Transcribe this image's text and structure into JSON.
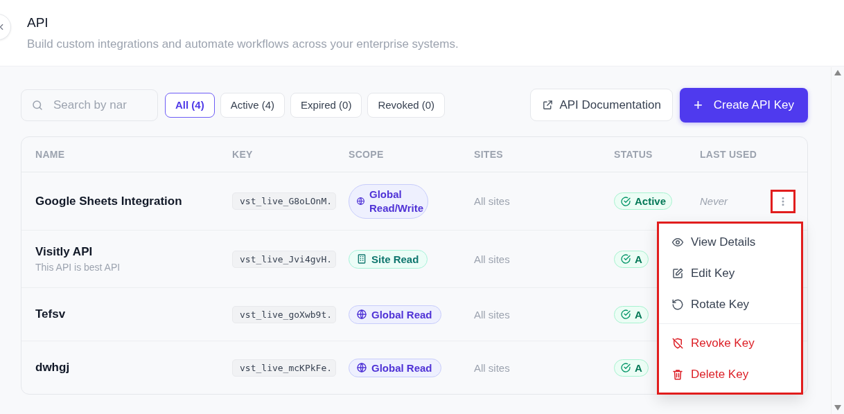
{
  "header": {
    "title": "API",
    "subtitle": "Build custom integrations and automate workflows across your enterprise systems."
  },
  "search": {
    "placeholder": "Search by nar"
  },
  "filters": [
    {
      "label": "All (4)",
      "selected": true
    },
    {
      "label": "Active (4)",
      "selected": false
    },
    {
      "label": "Expired (0)",
      "selected": false
    },
    {
      "label": "Revoked (0)",
      "selected": false
    }
  ],
  "buttons": {
    "docs": "API Documentation",
    "create_icon": "+",
    "create": "Create API Key"
  },
  "table": {
    "columns": [
      "NAME",
      "KEY",
      "SCOPE",
      "SITES",
      "STATUS",
      "LAST USED"
    ],
    "rows": [
      {
        "name": "Google Sheets Integration",
        "key": "vst_live_G8oLOnM.",
        "scope": {
          "kind": "global",
          "label": "Global Read/Write"
        },
        "sites": "All sites",
        "status": "Active",
        "last_used": "Never",
        "menu_open": true
      },
      {
        "name": "Visitly API",
        "description": "This API is best API",
        "key": "vst_live_Jvi4gvH.",
        "scope": {
          "kind": "site",
          "label": "Site Read"
        },
        "sites": "All sites",
        "status": "A"
      },
      {
        "name": "Tefsv",
        "key": "vst_live_goXwb9t.",
        "scope": {
          "kind": "global",
          "label": "Global Read"
        },
        "sites": "All sites",
        "status": "A"
      },
      {
        "name": "dwhgj",
        "key": "vst_live_mcKPkFe.",
        "scope": {
          "kind": "global",
          "label": "Global Read"
        },
        "sites": "All sites",
        "status": "A"
      }
    ]
  },
  "menu": [
    {
      "kind": "view",
      "label": "View Details"
    },
    {
      "kind": "edit",
      "label": "Edit Key"
    },
    {
      "kind": "rotate",
      "label": "Rotate Key"
    },
    {
      "kind": "revoke",
      "label": "Revoke Key"
    },
    {
      "kind": "delete",
      "label": "Delete Key"
    }
  ]
}
